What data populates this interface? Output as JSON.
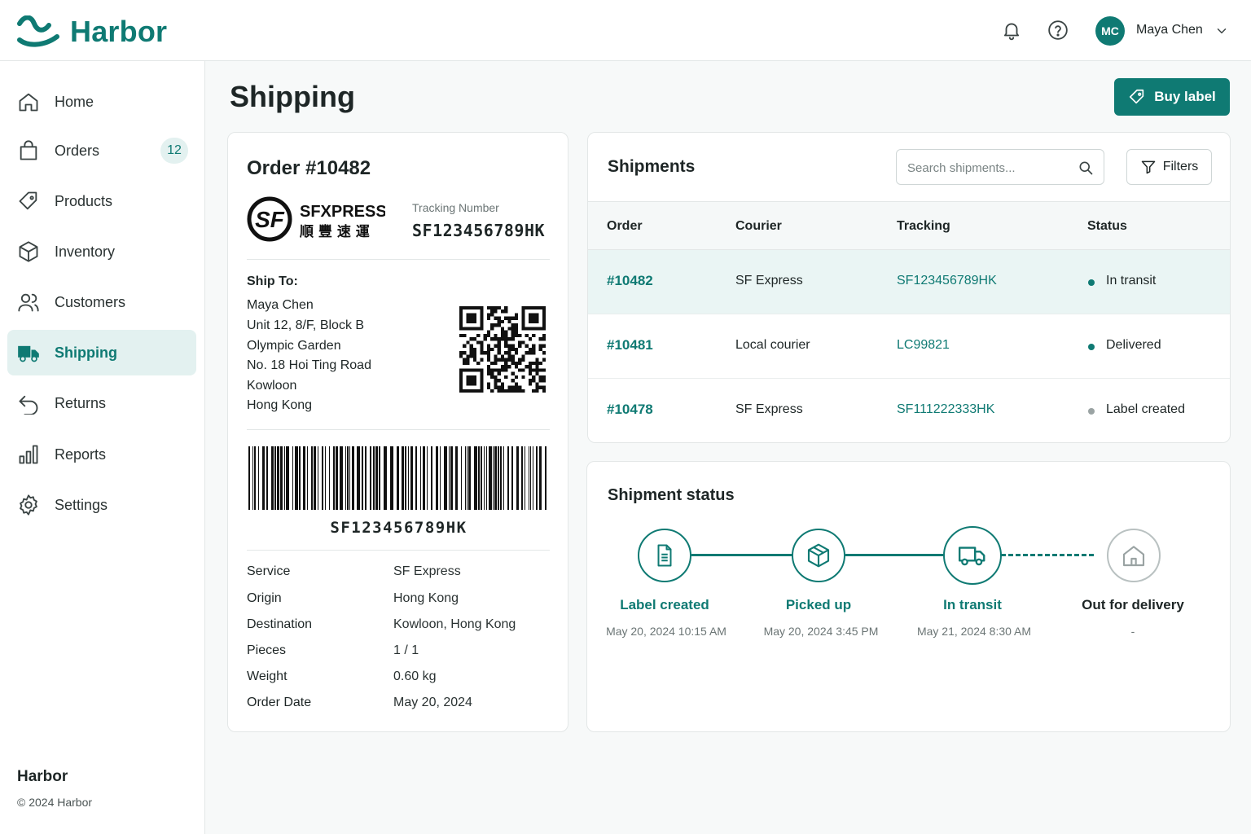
{
  "app": {
    "name": "Harbor"
  },
  "header": {
    "user": {
      "initials": "MC",
      "name": "Maya Chen"
    },
    "icons": [
      "bell-icon",
      "help-icon",
      "chevron-down-icon"
    ]
  },
  "sidebar": {
    "items": [
      {
        "label": "Home",
        "icon": "home-icon"
      },
      {
        "label": "Orders",
        "icon": "bag-icon",
        "badge": "12"
      },
      {
        "label": "Products",
        "icon": "tag-icon"
      },
      {
        "label": "Inventory",
        "icon": "box-icon"
      },
      {
        "label": "Customers",
        "icon": "users-icon"
      },
      {
        "label": "Shipping",
        "icon": "truck-icon",
        "active": true
      },
      {
        "label": "Returns",
        "icon": "return-icon"
      },
      {
        "label": "Reports",
        "icon": "bar-chart-icon"
      },
      {
        "label": "Settings",
        "icon": "gear-icon"
      }
    ],
    "footer": {
      "title": "Harbor",
      "copyright": "© 2024 Harbor"
    }
  },
  "page": {
    "title": "Shipping",
    "buy_label": "Buy label"
  },
  "order": {
    "title": "Order #10482",
    "courier_logo": {
      "name": "SFXPRESS",
      "chinese": "順 豐 速 運"
    },
    "tracking_label": "Tracking Number",
    "tracking_number": "SF123456789HK",
    "ship_to_label": "Ship To:",
    "address": [
      "Maya Chen",
      "Unit 12, 8/F, Block B",
      "Olympic Garden",
      "No. 18 Hoi Ting Road",
      "Kowloon",
      "Hong Kong"
    ],
    "barcode_text": "SF123456789HK",
    "details": [
      {
        "label": "Service",
        "value": "SF Express"
      },
      {
        "label": "Origin",
        "value": "Hong Kong"
      },
      {
        "label": "Destination",
        "value": "Kowloon, Hong Kong"
      },
      {
        "label": "Pieces",
        "value": "1 / 1"
      },
      {
        "label": "Weight",
        "value": "0.60 kg"
      },
      {
        "label": "Order Date",
        "value": "May 20, 2024"
      }
    ]
  },
  "shipments": {
    "title": "Shipments",
    "search_placeholder": "Search shipments...",
    "filters_label": "Filters",
    "columns": [
      "Order",
      "Courier",
      "Tracking",
      "Status"
    ],
    "rows": [
      {
        "order": "#10482",
        "courier": "SF Express",
        "tracking": "SF123456789HK",
        "status": "In transit",
        "status_color": "#0f7a73",
        "selected": true
      },
      {
        "order": "#10481",
        "courier": "Local courier",
        "tracking": "LC99821",
        "status": "Delivered",
        "status_color": "#0f7a73"
      },
      {
        "order": "#10478",
        "courier": "SF Express",
        "tracking": "SF111222333HK",
        "status": "Label created",
        "status_color": "#9aa3a3"
      }
    ]
  },
  "shipment_status": {
    "title": "Shipment status",
    "steps": [
      {
        "label": "Label created",
        "date": "May 20, 2024 10:15 AM",
        "icon": "document-icon",
        "done": true
      },
      {
        "label": "Picked up",
        "date": "May 20, 2024 3:45 PM",
        "icon": "package-icon",
        "done": true
      },
      {
        "label": "In transit",
        "date": "May 21, 2024 8:30 AM",
        "icon": "truck-icon",
        "done": true
      },
      {
        "label": "Out for delivery",
        "date": "-",
        "icon": "house-icon",
        "done": false
      }
    ]
  },
  "colors": {
    "brand": "#0f7a73",
    "brand_light": "#e3f1f0",
    "muted": "#9aa3a3"
  }
}
